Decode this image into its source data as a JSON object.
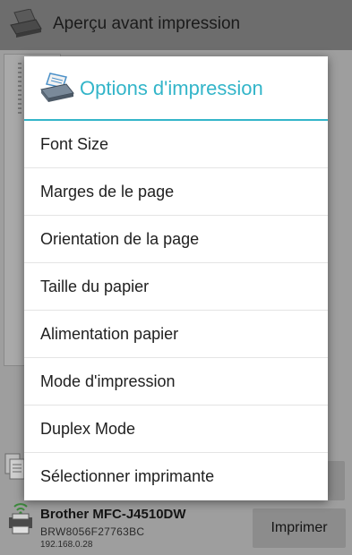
{
  "app": {
    "title": "Aperçu avant impression"
  },
  "printer": {
    "name": "Brother MFC-J4510DW",
    "id": "BRW8056F27763BC",
    "ip": "192.168.0.28",
    "print_label": "Imprimer"
  },
  "dialog": {
    "title": "Options d'impression",
    "items": [
      {
        "label": "Font Size"
      },
      {
        "label": "Marges de le page"
      },
      {
        "label": "Orientation de la page"
      },
      {
        "label": "Taille du papier"
      },
      {
        "label": "Alimentation papier"
      },
      {
        "label": "Mode d'impression"
      },
      {
        "label": "Duplex Mode"
      },
      {
        "label": "Sélectionner imprimante"
      }
    ]
  },
  "colors": {
    "accent": "#33b5c9",
    "appbar": "#6d6d6d",
    "scrim": "#9e9e9e"
  },
  "icons": {
    "appbar": "printer-icon",
    "dialog": "printer-icon",
    "documents": "documents-icon",
    "printer_status": "wifi-printer-icon"
  }
}
